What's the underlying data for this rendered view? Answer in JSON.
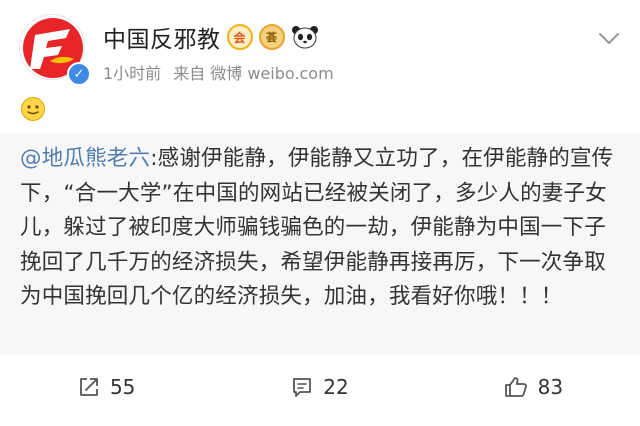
{
  "post": {
    "username": "中国反邪教",
    "time": "1小时前",
    "source": "来自 微博 weibo.com",
    "badges": {
      "vip": "会",
      "medal": "荟"
    },
    "avatar_glyph": "F",
    "emoji_line": "slightly-smiling-emoji"
  },
  "repost": {
    "mention": "@地瓜熊老六",
    "text": ":感谢伊能静，伊能静又立功了，在伊能静的宣传下，“合一大学”在中国的网站已经被关闭了，多少人的妻子女儿，躲过了被印度大师骗钱骗色的一劫，伊能静为中国一下子挽回了几千万的经济损失，希望伊能静再接再厉，下一次争取为中国挽回几个亿的经济损失，加油，我看好你哦！！！"
  },
  "actions": {
    "repost_count": "55",
    "comment_count": "22",
    "like_count": "83"
  },
  "colors": {
    "mention": "#507daf",
    "repost_bg": "#f7f7f7",
    "avatar_red": "#e8262a",
    "verified_blue": "#3d8be6"
  }
}
